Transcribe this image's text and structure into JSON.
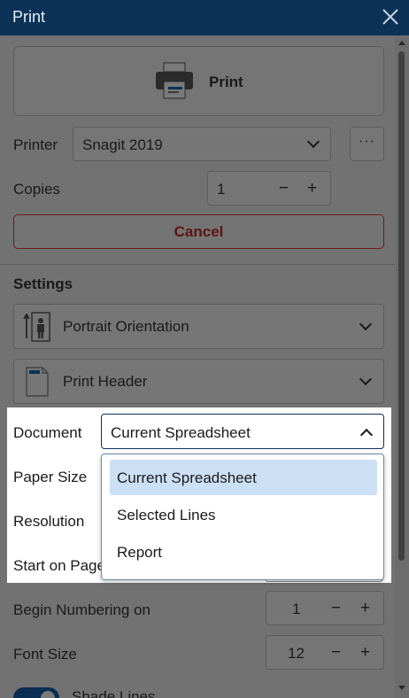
{
  "window": {
    "title": "Print"
  },
  "print_button": {
    "label": "Print"
  },
  "printer": {
    "label": "Printer",
    "selected": "Snagit 2019",
    "more_label": "···"
  },
  "copies": {
    "label": "Copies",
    "value": "1",
    "minus": "−",
    "plus": "+"
  },
  "cancel_button": {
    "label": "Cancel"
  },
  "settings": {
    "title": "Settings",
    "orientation": "Portrait Orientation",
    "header": "Print Header"
  },
  "document": {
    "label": "Document",
    "selected": "Current Spreadsheet",
    "options": [
      "Current Spreadsheet",
      "Selected Lines",
      "Report"
    ]
  },
  "fields": {
    "paper_size_label": "Paper Size",
    "resolution_label": "Resolution",
    "start_on_page_label": "Start on Page",
    "begin_numbering_label": "Begin Numbering on",
    "begin_numbering_value": "1",
    "font_size_label": "Font Size",
    "font_size_value": "12",
    "shade_lines_label": "Shade Lines"
  },
  "colors": {
    "titlebar": "#0c3257",
    "accent": "#0c3257",
    "cancel": "#b71c1c",
    "selected_option": "#cce0f5"
  }
}
